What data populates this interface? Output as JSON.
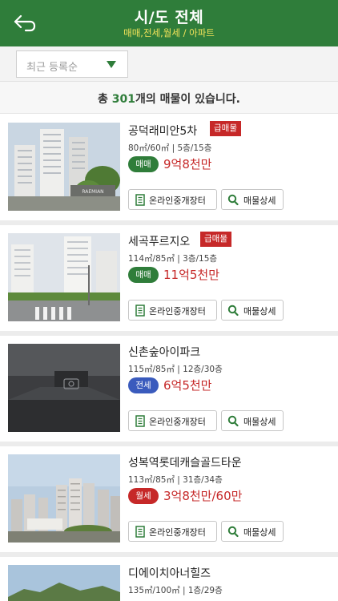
{
  "header": {
    "title": "시/도 전체",
    "subtitle": "매매,전세,월세 / 아파트",
    "back_icon": "back-arrow-icon"
  },
  "filter": {
    "sort_selected": "최근 등록순",
    "arrow_icon": "dropdown-triangle-icon"
  },
  "summary": {
    "prefix": "총 ",
    "count": "301",
    "suffix": "개의 매물이 있습니다."
  },
  "colors": {
    "brand_green": "#2f7d3a",
    "header_subtitle": "#f3e35a",
    "price_red": "#c62828",
    "urgent_red": "#c62828",
    "deal_sale": "#2f7d3a",
    "deal_jeonse": "#3a5bbd",
    "deal_monthly": "#c62828"
  },
  "listings": [
    {
      "name": "공덕래미안5차",
      "badge": "급매물",
      "spec": "80㎡/60㎡ | 5층/15층",
      "deal_type": "매매",
      "deal_color": "#2f7d3a",
      "price": "9억8천만",
      "broker_label": "온라인중개장터",
      "detail_label": "매물상세",
      "photo_text": "RAEMIAN"
    },
    {
      "name": "세곡푸르지오",
      "badge": "급매물",
      "spec": "114㎡/85㎡ | 3층/15층",
      "deal_type": "매매",
      "deal_color": "#2f7d3a",
      "price": "11억5천만",
      "broker_label": "온라인중개장터",
      "detail_label": "매물상세",
      "photo_text": ""
    },
    {
      "name": "신촌숲아이파크",
      "badge": "",
      "spec": "115㎡/85㎡ | 12층/30층",
      "deal_type": "전세",
      "deal_color": "#3a5bbd",
      "price": "6억5천만",
      "broker_label": "온라인중개장터",
      "detail_label": "매물상세",
      "photo_text": ""
    },
    {
      "name": "성복역롯데캐슬골드타운",
      "badge": "",
      "spec": "113㎡/85㎡ | 31층/34층",
      "deal_type": "월세",
      "deal_color": "#c62828",
      "price": "3억8천만/60만",
      "broker_label": "온라인중개장터",
      "detail_label": "매물상세",
      "photo_text": ""
    },
    {
      "name": "디에이치아너힐즈",
      "badge": "",
      "spec": "135㎡/100㎡ | 1층/29층",
      "deal_type": "",
      "deal_color": "#2f7d3a",
      "price": "",
      "broker_label": "",
      "detail_label": "",
      "photo_text": ""
    }
  ]
}
